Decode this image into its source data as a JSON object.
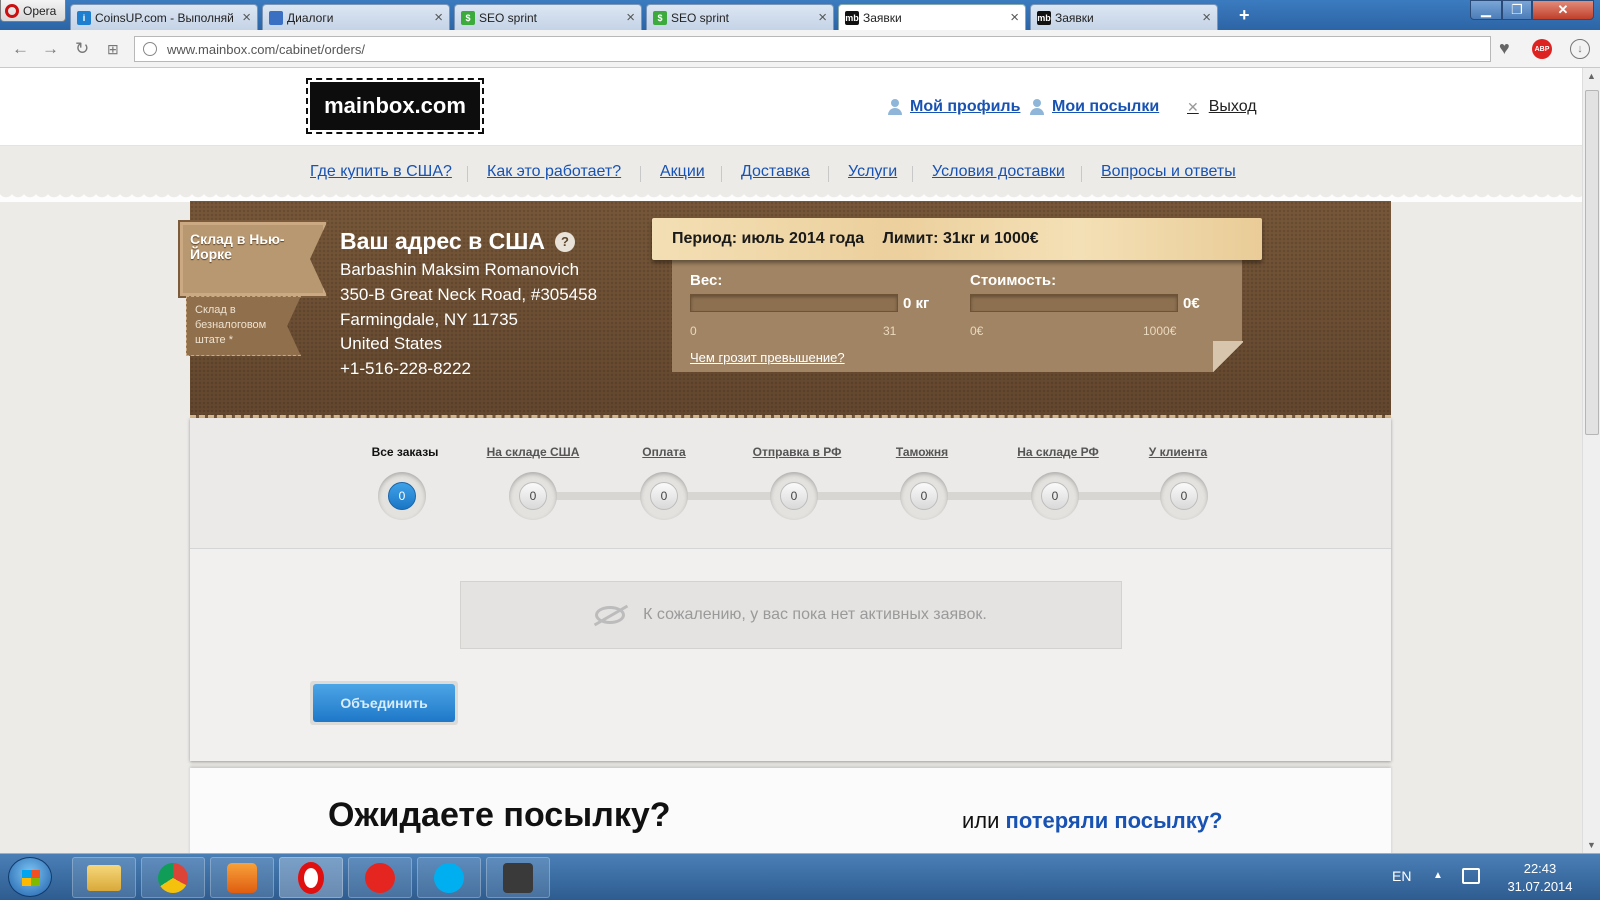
{
  "browser": {
    "menu_label": "Opera",
    "tabs": [
      {
        "title": "CoinsUP.com - Выполняй",
        "favicon_color": "#1e7fd0",
        "active": false
      },
      {
        "title": "Диалоги",
        "favicon_color": "#3a6fc2",
        "active": false
      },
      {
        "title": "SEO sprint",
        "favicon_color": "#3daa3d",
        "active": false
      },
      {
        "title": "SEO sprint",
        "favicon_color": "#3daa3d",
        "active": false
      },
      {
        "title": "Заявки",
        "favicon_color": "#111111",
        "active": true
      },
      {
        "title": "Заявки",
        "favicon_color": "#111111",
        "active": false
      }
    ],
    "new_tab_label": "+",
    "url": "www.mainbox.com/cabinet/orders/",
    "favicon_mb": "mb"
  },
  "site": {
    "logo": "mainbox.com",
    "header_links": {
      "profile": "Мой профиль",
      "parcels": "Мои посылки",
      "logout": "Выход"
    },
    "nav": [
      "Где купить в США?",
      "Как это работает?",
      "Акции",
      "Доставка",
      "Услуги",
      "Условия доставки",
      "Вопросы и ответы"
    ],
    "warehouse": {
      "primary": "Склад в Нью-Йорке",
      "secondary": "Склад в безналоговом штате *"
    },
    "address": {
      "title": "Ваш адрес в США",
      "help": "?",
      "lines": [
        "Barbashin Maksim Romanovich",
        "350-B Great Neck Road, #305458",
        "Farmingdale, NY 11735",
        "United States",
        "+1-516-228-8222"
      ]
    },
    "limits": {
      "period": "Период: июль 2014 года",
      "limit": "Лимит: 31кг и 1000€",
      "weight_label": "Вес:",
      "weight_value": "0 кг",
      "weight_fill": 0,
      "weight_min": "0",
      "weight_max": "31",
      "cost_label": "Стоимость:",
      "cost_value": "0€",
      "cost_fill": 0,
      "cost_min": "0€",
      "cost_max": "1000€",
      "exceed_link": "Чем грозит превышение?"
    },
    "statuses": [
      {
        "label": "Все заказы",
        "count": "0",
        "current": true
      },
      {
        "label": "На складе США",
        "count": "0",
        "current": false
      },
      {
        "label": "Оплата",
        "count": "0",
        "current": false
      },
      {
        "label": "Отправка в РФ",
        "count": "0",
        "current": false
      },
      {
        "label": "Таможня",
        "count": "0",
        "current": false
      },
      {
        "label": "На складе РФ",
        "count": "0",
        "current": false
      },
      {
        "label": "У клиента",
        "count": "0",
        "current": false
      }
    ],
    "empty_message": "К сожалению, у вас пока нет активных заявок.",
    "merge_button": "Объединить",
    "await_title": "Ожидаете посылку?",
    "lost_prefix": "или",
    "lost_link": "потеряли посылку?"
  },
  "taskbar": {
    "lang": "EN",
    "time": "22:43",
    "date": "31.07.2014"
  }
}
